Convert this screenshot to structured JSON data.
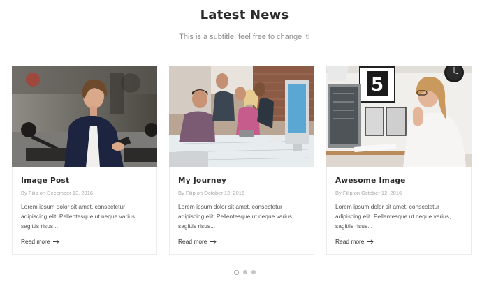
{
  "section": {
    "title": "Latest News",
    "subtitle": "This is a subtitle, feel free to change it!"
  },
  "posts": [
    {
      "title": "Image Post",
      "meta_prefix": "By",
      "author": "Filip",
      "meta_on": "on",
      "date": "December 13, 2016",
      "excerpt_lines": [
        "Lorem ipsum dolor sit amet, consectetur",
        "adipiscing elit. Pellentesque ut neque varius,",
        "sagittis risus..."
      ],
      "read_more": "Read more",
      "image_icon": "woman-phone-scooter-photo"
    },
    {
      "title": "My Journey",
      "meta_prefix": "By",
      "author": "Filip",
      "meta_on": "on",
      "date": "October 12, 2016",
      "excerpt_lines": [
        "Lorem ipsum dolor sit amet, consectetur",
        "adipiscing elit. Pellentesque ut neque varius,",
        "sagittis risus..."
      ],
      "read_more": "Read more",
      "image_icon": "team-around-computer-photo"
    },
    {
      "title": "Awesome Image",
      "meta_prefix": "By",
      "author": "Filip",
      "meta_on": "on",
      "date": "October 12, 2016",
      "excerpt_lines": [
        "Lorem ipsum dolor sit amet, consectetur",
        "adipiscing elit. Pellentesque ut neque varius,",
        "sagittis risus..."
      ],
      "read_more": "Read more",
      "image_icon": "woman-at-desk-photo"
    }
  ],
  "carousel": {
    "active_index": 0,
    "page_count": 3
  },
  "colors": {
    "title": "#2b2b2b",
    "subtitle": "#8d8d8d",
    "meta": "#a8a8a8",
    "card_border": "#ececec"
  }
}
